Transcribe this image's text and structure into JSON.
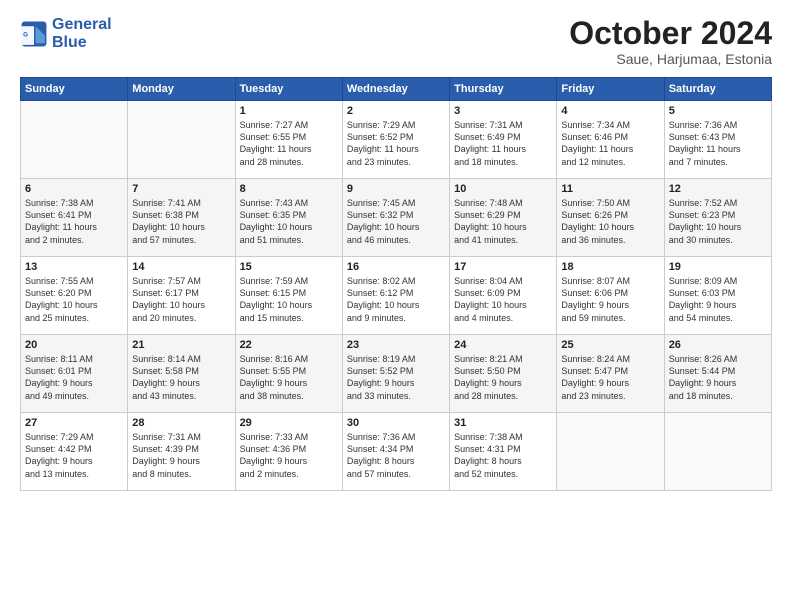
{
  "header": {
    "logo_line1": "General",
    "logo_line2": "Blue",
    "month_title": "October 2024",
    "location": "Saue, Harjumaa, Estonia"
  },
  "weekdays": [
    "Sunday",
    "Monday",
    "Tuesday",
    "Wednesday",
    "Thursday",
    "Friday",
    "Saturday"
  ],
  "weeks": [
    [
      {
        "day": "",
        "text": ""
      },
      {
        "day": "",
        "text": ""
      },
      {
        "day": "1",
        "text": "Sunrise: 7:27 AM\nSunset: 6:55 PM\nDaylight: 11 hours\nand 28 minutes."
      },
      {
        "day": "2",
        "text": "Sunrise: 7:29 AM\nSunset: 6:52 PM\nDaylight: 11 hours\nand 23 minutes."
      },
      {
        "day": "3",
        "text": "Sunrise: 7:31 AM\nSunset: 6:49 PM\nDaylight: 11 hours\nand 18 minutes."
      },
      {
        "day": "4",
        "text": "Sunrise: 7:34 AM\nSunset: 6:46 PM\nDaylight: 11 hours\nand 12 minutes."
      },
      {
        "day": "5",
        "text": "Sunrise: 7:36 AM\nSunset: 6:43 PM\nDaylight: 11 hours\nand 7 minutes."
      }
    ],
    [
      {
        "day": "6",
        "text": "Sunrise: 7:38 AM\nSunset: 6:41 PM\nDaylight: 11 hours\nand 2 minutes."
      },
      {
        "day": "7",
        "text": "Sunrise: 7:41 AM\nSunset: 6:38 PM\nDaylight: 10 hours\nand 57 minutes."
      },
      {
        "day": "8",
        "text": "Sunrise: 7:43 AM\nSunset: 6:35 PM\nDaylight: 10 hours\nand 51 minutes."
      },
      {
        "day": "9",
        "text": "Sunrise: 7:45 AM\nSunset: 6:32 PM\nDaylight: 10 hours\nand 46 minutes."
      },
      {
        "day": "10",
        "text": "Sunrise: 7:48 AM\nSunset: 6:29 PM\nDaylight: 10 hours\nand 41 minutes."
      },
      {
        "day": "11",
        "text": "Sunrise: 7:50 AM\nSunset: 6:26 PM\nDaylight: 10 hours\nand 36 minutes."
      },
      {
        "day": "12",
        "text": "Sunrise: 7:52 AM\nSunset: 6:23 PM\nDaylight: 10 hours\nand 30 minutes."
      }
    ],
    [
      {
        "day": "13",
        "text": "Sunrise: 7:55 AM\nSunset: 6:20 PM\nDaylight: 10 hours\nand 25 minutes."
      },
      {
        "day": "14",
        "text": "Sunrise: 7:57 AM\nSunset: 6:17 PM\nDaylight: 10 hours\nand 20 minutes."
      },
      {
        "day": "15",
        "text": "Sunrise: 7:59 AM\nSunset: 6:15 PM\nDaylight: 10 hours\nand 15 minutes."
      },
      {
        "day": "16",
        "text": "Sunrise: 8:02 AM\nSunset: 6:12 PM\nDaylight: 10 hours\nand 9 minutes."
      },
      {
        "day": "17",
        "text": "Sunrise: 8:04 AM\nSunset: 6:09 PM\nDaylight: 10 hours\nand 4 minutes."
      },
      {
        "day": "18",
        "text": "Sunrise: 8:07 AM\nSunset: 6:06 PM\nDaylight: 9 hours\nand 59 minutes."
      },
      {
        "day": "19",
        "text": "Sunrise: 8:09 AM\nSunset: 6:03 PM\nDaylight: 9 hours\nand 54 minutes."
      }
    ],
    [
      {
        "day": "20",
        "text": "Sunrise: 8:11 AM\nSunset: 6:01 PM\nDaylight: 9 hours\nand 49 minutes."
      },
      {
        "day": "21",
        "text": "Sunrise: 8:14 AM\nSunset: 5:58 PM\nDaylight: 9 hours\nand 43 minutes."
      },
      {
        "day": "22",
        "text": "Sunrise: 8:16 AM\nSunset: 5:55 PM\nDaylight: 9 hours\nand 38 minutes."
      },
      {
        "day": "23",
        "text": "Sunrise: 8:19 AM\nSunset: 5:52 PM\nDaylight: 9 hours\nand 33 minutes."
      },
      {
        "day": "24",
        "text": "Sunrise: 8:21 AM\nSunset: 5:50 PM\nDaylight: 9 hours\nand 28 minutes."
      },
      {
        "day": "25",
        "text": "Sunrise: 8:24 AM\nSunset: 5:47 PM\nDaylight: 9 hours\nand 23 minutes."
      },
      {
        "day": "26",
        "text": "Sunrise: 8:26 AM\nSunset: 5:44 PM\nDaylight: 9 hours\nand 18 minutes."
      }
    ],
    [
      {
        "day": "27",
        "text": "Sunrise: 7:29 AM\nSunset: 4:42 PM\nDaylight: 9 hours\nand 13 minutes."
      },
      {
        "day": "28",
        "text": "Sunrise: 7:31 AM\nSunset: 4:39 PM\nDaylight: 9 hours\nand 8 minutes."
      },
      {
        "day": "29",
        "text": "Sunrise: 7:33 AM\nSunset: 4:36 PM\nDaylight: 9 hours\nand 2 minutes."
      },
      {
        "day": "30",
        "text": "Sunrise: 7:36 AM\nSunset: 4:34 PM\nDaylight: 8 hours\nand 57 minutes."
      },
      {
        "day": "31",
        "text": "Sunrise: 7:38 AM\nSunset: 4:31 PM\nDaylight: 8 hours\nand 52 minutes."
      },
      {
        "day": "",
        "text": ""
      },
      {
        "day": "",
        "text": ""
      }
    ]
  ]
}
